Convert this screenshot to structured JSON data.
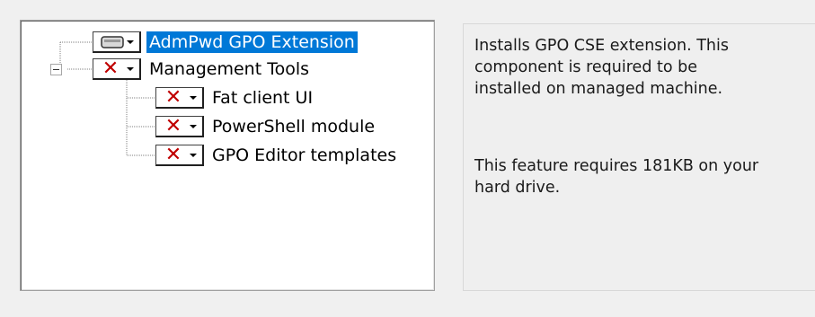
{
  "tree": {
    "items": [
      {
        "label": "AdmPwd GPO Extension",
        "icon": "hard-drive-icon",
        "selected": true
      },
      {
        "label": "Management Tools",
        "icon": "unavailable-x-icon",
        "expanded": true
      },
      {
        "label": "Fat client UI",
        "icon": "unavailable-x-icon"
      },
      {
        "label": "PowerShell module",
        "icon": "unavailable-x-icon"
      },
      {
        "label": "GPO Editor templates",
        "icon": "unavailable-x-icon"
      }
    ]
  },
  "description": {
    "text": "Installs GPO CSE extension. This component is required to be installed on managed machine.",
    "line1": "Installs GPO CSE extension. This",
    "line2": "component is required to be",
    "line3": "installed on managed machine.",
    "size_line1": "This feature requires 181KB on your",
    "size_line2": "hard drive."
  },
  "icons": {
    "x_glyph": "✕"
  },
  "colors": {
    "selection": "#0078d7",
    "x_red": "#c00000"
  }
}
